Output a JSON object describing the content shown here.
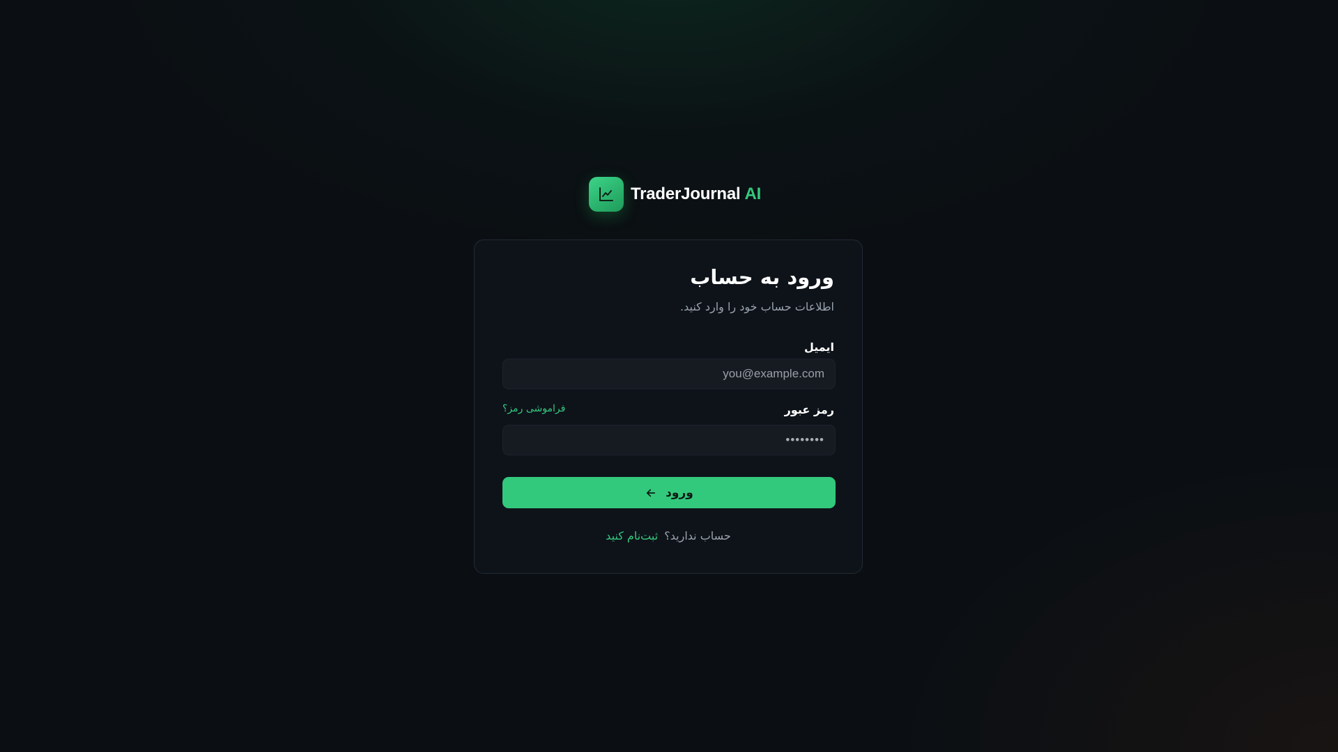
{
  "brand": {
    "name": "TraderJournal",
    "suffix": "AI",
    "logo_icon": "line-chart-icon"
  },
  "login_card": {
    "title": "ورود به حساب",
    "subtitle": "اطلاعات حساب خود را وارد کنید.",
    "email": {
      "label": "ایمیل",
      "placeholder": "you@example.com",
      "value": ""
    },
    "password": {
      "label": "رمز عبور",
      "placeholder": "••••••••",
      "value": "",
      "forgot_link": "فراموشی رمز؟"
    },
    "submit": {
      "label": "ورود",
      "icon": "arrow-left-icon"
    },
    "signup": {
      "prompt": "حساب ندارید؟",
      "link": "ثبت‌نام کنید"
    }
  },
  "colors": {
    "accent": "#34c97e",
    "background": "#0b0f13",
    "card": "#0e131a",
    "input": "#161b22"
  }
}
